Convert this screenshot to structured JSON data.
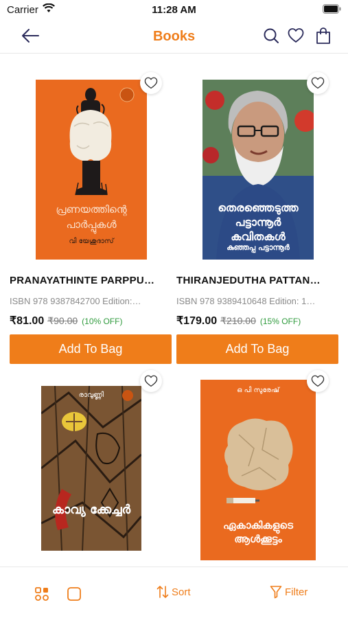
{
  "status_bar": {
    "carrier": "Carrier",
    "time": "11:28 AM"
  },
  "header": {
    "title": "Books"
  },
  "products": [
    {
      "title": "PRANAYATHINTE PARPPU…",
      "isbn": "ISBN 978 9387842700 Edition:…",
      "price": "₹81.00",
      "mrp": "₹90.00",
      "discount": "(10% OFF)",
      "button": "Add To Bag",
      "cover": {
        "title_ml": "പ്രണയത്തിന്റെ പാർപ്പുകൾ",
        "author_ml": "വി യേശുദാസ്"
      }
    },
    {
      "title": "THIRANJEDUTHA PATTAN…",
      "isbn": "ISBN 978 9389410648 Edition: 1…",
      "price": "₹179.00",
      "mrp": "₹210.00",
      "discount": "(15% OFF)",
      "button": "Add To Bag",
      "cover": {
        "title_ml": "തെരഞ്ഞെടുത്ത പട്ടാന്നൂർ കവിതകൾ",
        "author_ml": "കുഞ്ഞപ്പ പട്ടാന്നൂർ"
      }
    },
    {
      "cover": {
        "title_ml": "കാവ്യ ക്കേച്ചർ",
        "author_ml": "രാവുണ്ണി"
      }
    },
    {
      "cover": {
        "title_ml": "ഏകാകികളുടെ ആൾക്കൂട്ടം",
        "author_ml": "ഒ പി സുരേഷ്"
      }
    }
  ],
  "bottom_bar": {
    "sort": "Sort",
    "filter": "Filter"
  },
  "colors": {
    "accent": "#ef7d1a",
    "discount": "#2e9a3c"
  }
}
